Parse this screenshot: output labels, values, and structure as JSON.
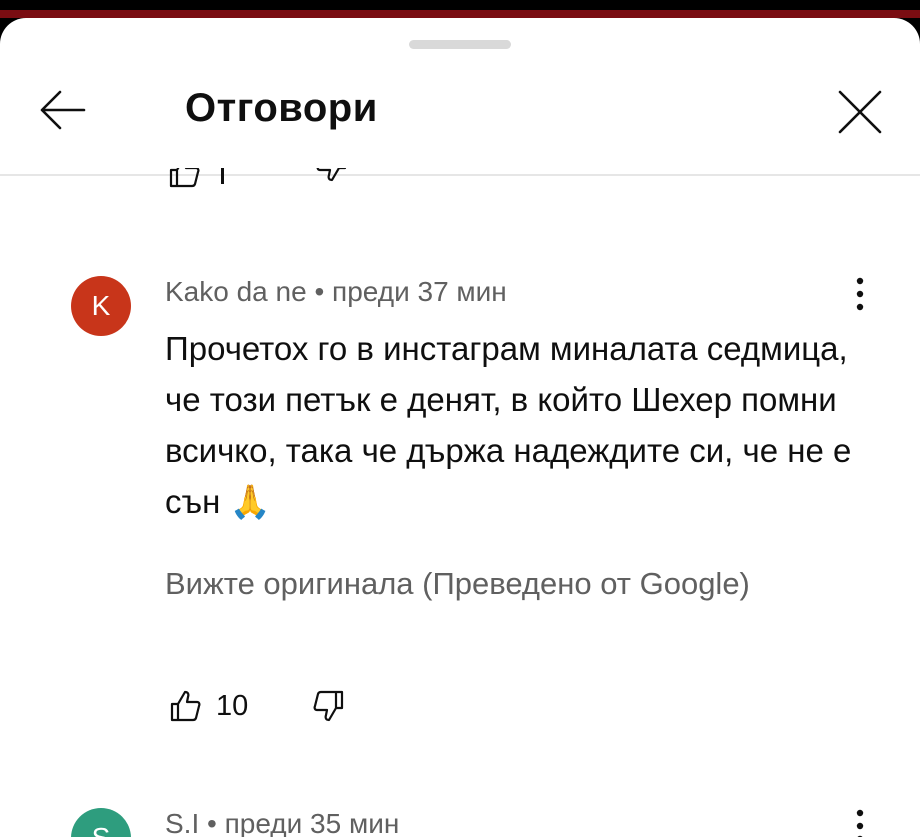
{
  "header": {
    "title": "Отговори"
  },
  "comments": [
    {
      "avatar_letter": "K",
      "avatar_color": "#c8351a",
      "author": "Kako da ne",
      "separator": "•",
      "time": "преди 37 мин",
      "text": "Прочетох го в инстаграм миналата седмица, че този петък е денят, в който Шехер помни всичко, така че държа надеждите си, че не е сън 🙏",
      "translate_link": "Вижте оригинала (Преведено от Google)",
      "likes": "10"
    },
    {
      "avatar_letter": "S",
      "avatar_color": "#2e9d7e",
      "author": "S.I",
      "separator": "•",
      "time": "преди 35 мин"
    }
  ]
}
